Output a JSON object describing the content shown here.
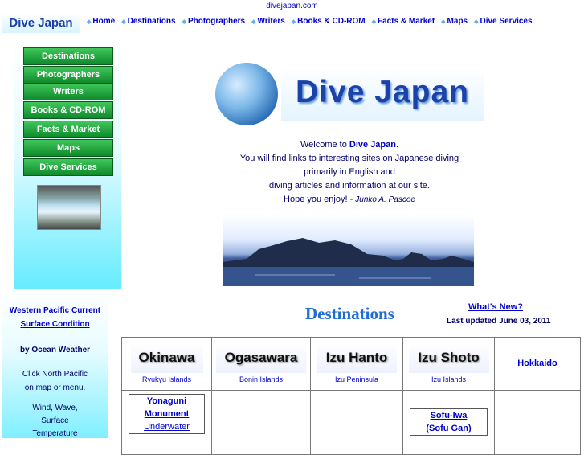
{
  "site": {
    "domain": "divejapan.com",
    "logo_text": "Dive Japan"
  },
  "topnav": [
    "Home",
    "Destinations",
    "Photographers",
    "Writers",
    "Books & CD-ROM",
    "Facts & Market",
    "Maps",
    "Dive Services"
  ],
  "sidenav": [
    "Destinations",
    "Photographers",
    "Writers",
    "Books & CD-ROM",
    "Facts & Market",
    "Maps",
    "Dive Services"
  ],
  "leftpanel": {
    "link1": "Western Pacific Current",
    "link2": "Surface Condition",
    "by": "by Ocean Weather",
    "click1": "Click North Pacific",
    "click2": "on map or menu.",
    "wind1": "Wind, Wave,",
    "wind2": "Surface",
    "wind3": "Temperature"
  },
  "banner_text": "Dive Japan",
  "welcome": {
    "line1_pre": "Welcome to ",
    "line1_bold": "Dive Japan",
    "line1_post": ".",
    "line2": "You will find links to interesting sites on Japanese diving",
    "line3": "primarily in English and",
    "line4": "diving articles and information at our site.",
    "line5": "Hope you enjoy! - ",
    "signature": "Junko A. Pascoe"
  },
  "destinations": {
    "title": "Destinations",
    "whats_new": "What's New?",
    "last_updated": "Last updated June 03, 2011",
    "row1": [
      {
        "name": "Okinawa",
        "sub": "Ryukyu Islands"
      },
      {
        "name": "Ogasawara",
        "sub": "Bonin Islands"
      },
      {
        "name": "Izu Hanto",
        "sub": "Izu Peninsula"
      },
      {
        "name": "Izu Shoto",
        "sub": "Izu Islands"
      },
      {
        "name": "Hokkaido",
        "sub": ""
      }
    ],
    "row2": {
      "yonaguni_1": "Yonaguni",
      "yonaguni_2": "Monument",
      "yonaguni_3": "Underwater",
      "sofu_1": "Sofu-Iwa",
      "sofu_2": "(Sofu Gan)"
    }
  },
  "colors": {
    "nav_green": "#1ea33d",
    "link_blue": "#0000cc",
    "title_blue": "#1f6ed8",
    "cyan": "#66ecff"
  }
}
